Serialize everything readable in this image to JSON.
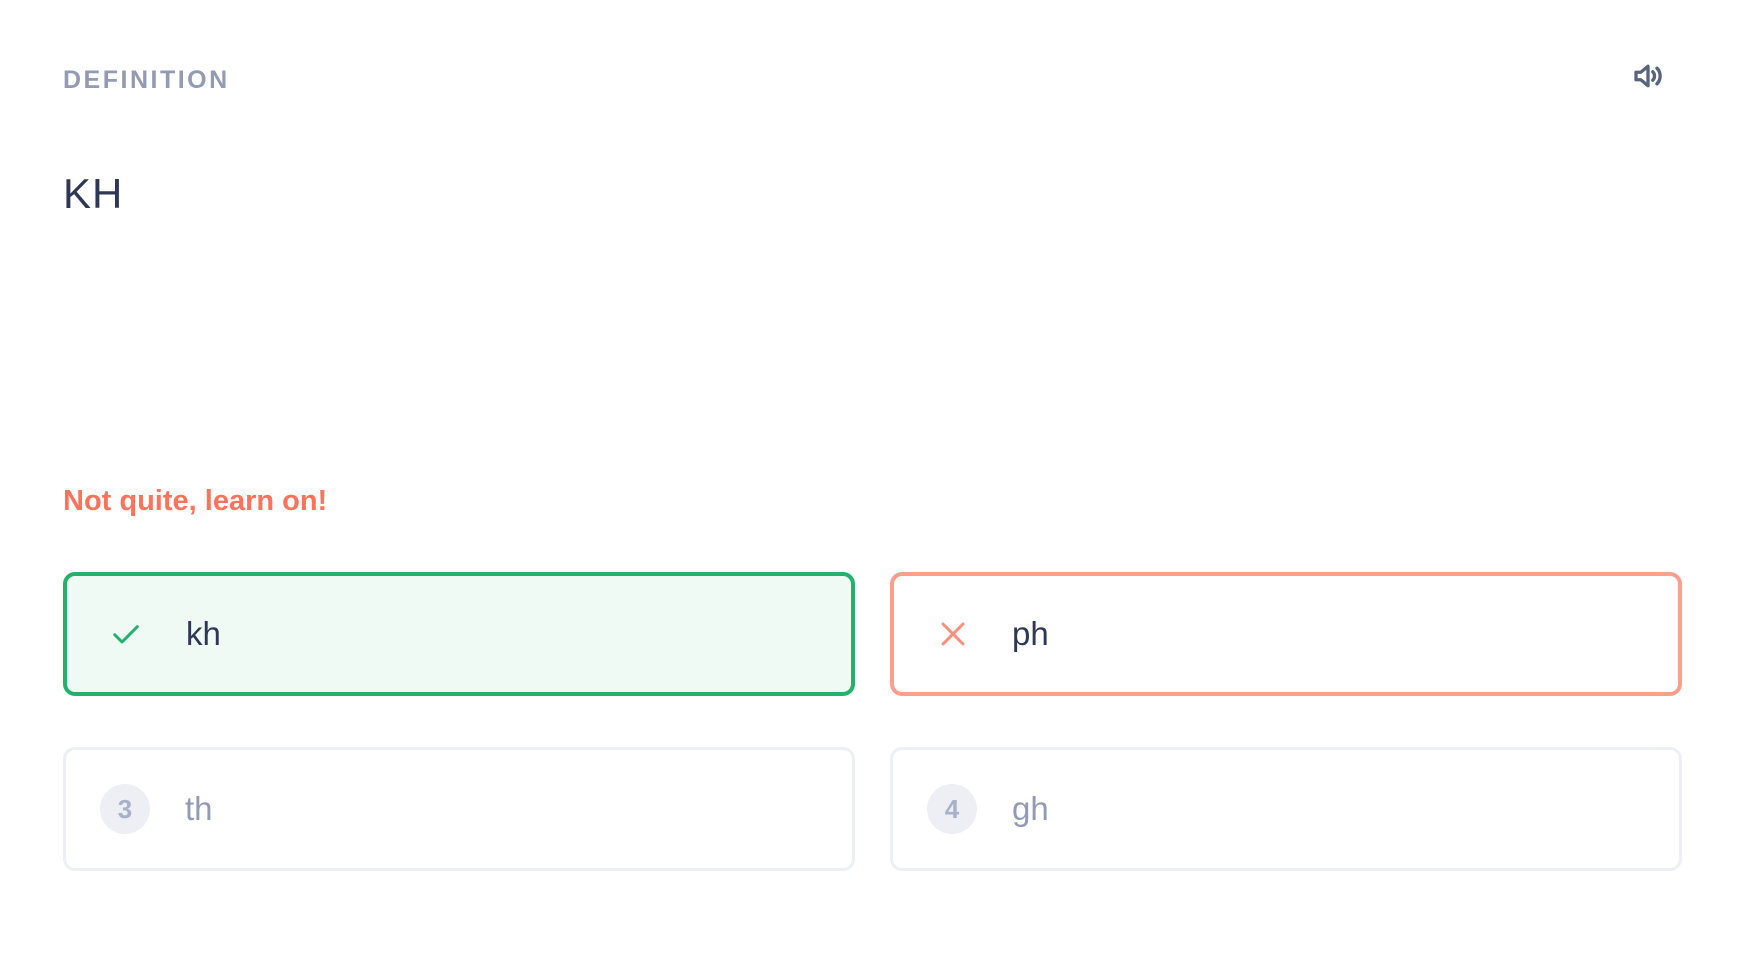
{
  "header": {
    "label": "DEFINITION",
    "audio_icon": "speaker-icon"
  },
  "term": "KH",
  "feedback": {
    "message": "Not quite, learn on!",
    "color": "#ff725b"
  },
  "options": [
    {
      "text": "kh",
      "state": "correct",
      "marker": "check-icon",
      "color": "#23b26d"
    },
    {
      "text": "ph",
      "state": "incorrect",
      "marker": "x-icon",
      "color": "#ff9e8a"
    },
    {
      "text": "th",
      "state": "neutral",
      "number": "3"
    },
    {
      "text": "gh",
      "state": "neutral",
      "number": "4"
    }
  ],
  "colors": {
    "muted": "#939bb4",
    "text": "#2e3856",
    "correct_bg": "#effaf4",
    "neutral_border": "#edeff4"
  }
}
